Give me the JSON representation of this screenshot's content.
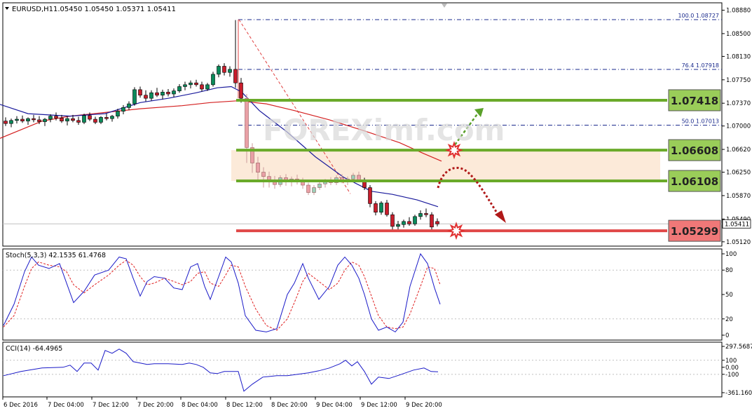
{
  "chart_data": {
    "type": "candlestick",
    "symbol": "EURUSD,H1",
    "ohlc_header": "1.05450 1.05450 1.05371 1.05411",
    "last_price": "1.05411",
    "ylim": [
      1.0505,
      1.09
    ],
    "price_ticks": [
      "1.08880",
      "1.08500",
      "1.08130",
      "1.07750",
      "1.07370",
      "1.07000",
      "1.06620",
      "1.06250",
      "1.05870",
      "1.05490",
      "1.05120"
    ],
    "time_labels": [
      "6 Dec 2016",
      "7 Dec 04:00",
      "7 Dec 12:00",
      "7 Dec 20:00",
      "8 Dec 04:00",
      "8 Dec 12:00",
      "8 Dec 20:00",
      "9 Dec 04:00",
      "9 Dec 12:00",
      "9 Dec 20:00"
    ],
    "fibonacci": [
      {
        "label": "100.0  1.08727",
        "price": 1.08727
      },
      {
        "label": "76.4  1.07918",
        "price": 1.07918
      },
      {
        "label": "50.0  1.07013",
        "price": 1.07013
      }
    ],
    "levels": [
      {
        "label": "1.07418",
        "price": 1.07418,
        "color": "#6aaa2a",
        "box": "#9acd59"
      },
      {
        "label": "1.06608",
        "price": 1.06608,
        "color": "#6aaa2a",
        "box": "#9acd59"
      },
      {
        "label": "1.06108",
        "price": 1.06108,
        "color": "#6aaa2a",
        "box": "#9acd59"
      },
      {
        "label": "1.05299",
        "price": 1.05299,
        "color": "#e04848",
        "box": "#f07878"
      }
    ],
    "zone": [
      1.06108,
      1.06608
    ],
    "candles": [
      [
        1.0708,
        1.0714,
        1.07,
        1.0704
      ],
      [
        1.0704,
        1.0712,
        1.0698,
        1.0709
      ],
      [
        1.0709,
        1.0716,
        1.0704,
        1.0711
      ],
      [
        1.0711,
        1.0717,
        1.0705,
        1.0708
      ],
      [
        1.0708,
        1.0714,
        1.0702,
        1.0712
      ],
      [
        1.0712,
        1.0718,
        1.0706,
        1.071
      ],
      [
        1.071,
        1.0716,
        1.0703,
        1.0707
      ],
      [
        1.0707,
        1.0713,
        1.07,
        1.0711
      ],
      [
        1.0711,
        1.0719,
        1.0706,
        1.0716
      ],
      [
        1.0716,
        1.0722,
        1.0709,
        1.0713
      ],
      [
        1.0713,
        1.0718,
        1.0705,
        1.0708
      ],
      [
        1.0708,
        1.0716,
        1.0701,
        1.0712
      ],
      [
        1.0712,
        1.0718,
        1.0706,
        1.0709
      ],
      [
        1.0709,
        1.0715,
        1.0702,
        1.0706
      ],
      [
        1.0706,
        1.072,
        1.0703,
        1.0717
      ],
      [
        1.0717,
        1.0722,
        1.0708,
        1.0711
      ],
      [
        1.0711,
        1.0715,
        1.0703,
        1.0706
      ],
      [
        1.0706,
        1.0716,
        1.0703,
        1.0714
      ],
      [
        1.0714,
        1.072,
        1.0709,
        1.0712
      ],
      [
        1.0712,
        1.0718,
        1.0707,
        1.0716
      ],
      [
        1.0716,
        1.0728,
        1.0712,
        1.0724
      ],
      [
        1.0724,
        1.0734,
        1.0719,
        1.073
      ],
      [
        1.073,
        1.074,
        1.0726,
        1.0736
      ],
      [
        1.0736,
        1.0763,
        1.0733,
        1.0759
      ],
      [
        1.0759,
        1.0764,
        1.0746,
        1.075
      ],
      [
        1.075,
        1.0758,
        1.074,
        1.0745
      ],
      [
        1.0745,
        1.0758,
        1.0741,
        1.0754
      ],
      [
        1.0754,
        1.0762,
        1.0747,
        1.075
      ],
      [
        1.075,
        1.0759,
        1.0743,
        1.0755
      ],
      [
        1.0755,
        1.076,
        1.0748,
        1.0752
      ],
      [
        1.0752,
        1.0761,
        1.0747,
        1.0757
      ],
      [
        1.0757,
        1.0768,
        1.0754,
        1.0764
      ],
      [
        1.0764,
        1.0772,
        1.0758,
        1.0767
      ],
      [
        1.0767,
        1.0774,
        1.0761,
        1.077
      ],
      [
        1.077,
        1.0775,
        1.0764,
        1.0767
      ],
      [
        1.0767,
        1.0772,
        1.0756,
        1.076
      ],
      [
        1.076,
        1.077,
        1.0757,
        1.0767
      ],
      [
        1.0767,
        1.0788,
        1.0764,
        1.0784
      ],
      [
        1.0784,
        1.08,
        1.0779,
        1.0797
      ],
      [
        1.0797,
        1.0802,
        1.0782,
        1.0787
      ],
      [
        1.0787,
        1.0797,
        1.078,
        1.0792
      ],
      [
        1.0792,
        1.0872,
        1.0762,
        1.077
      ],
      [
        1.077,
        1.0778,
        1.0738,
        1.0745
      ],
      [
        1.0745,
        1.0752,
        1.064,
        1.0665
      ],
      [
        1.0665,
        1.0672,
        1.0624,
        1.064
      ],
      [
        1.064,
        1.065,
        1.0612,
        1.0625
      ],
      [
        1.0625,
        1.0633,
        1.06,
        1.0618
      ],
      [
        1.0618,
        1.0626,
        1.06,
        1.061
      ],
      [
        1.061,
        1.0619,
        1.0598,
        1.0605
      ],
      [
        1.0605,
        1.062,
        1.0601,
        1.0616
      ],
      [
        1.0616,
        1.0622,
        1.0603,
        1.0609
      ],
      [
        1.0609,
        1.0618,
        1.0602,
        1.0614
      ],
      [
        1.0614,
        1.0621,
        1.0605,
        1.061
      ],
      [
        1.061,
        1.0616,
        1.0598,
        1.0604
      ],
      [
        1.0604,
        1.0608,
        1.0588,
        1.0592
      ],
      [
        1.0592,
        1.0604,
        1.0588,
        1.06
      ],
      [
        1.06,
        1.061,
        1.0596,
        1.0606
      ],
      [
        1.0606,
        1.0614,
        1.06,
        1.0611
      ],
      [
        1.0611,
        1.0617,
        1.0604,
        1.0608
      ],
      [
        1.0608,
        1.062,
        1.0604,
        1.0616
      ],
      [
        1.0616,
        1.0622,
        1.0607,
        1.0612
      ],
      [
        1.0612,
        1.0618,
        1.0604,
        1.0614
      ],
      [
        1.0614,
        1.0624,
        1.0608,
        1.062
      ],
      [
        1.062,
        1.0626,
        1.061,
        1.0612
      ],
      [
        1.0612,
        1.0616,
        1.0596,
        1.06
      ],
      [
        1.06,
        1.0604,
        1.0568,
        1.0574
      ],
      [
        1.0574,
        1.0578,
        1.0555,
        1.056
      ],
      [
        1.056,
        1.0578,
        1.0556,
        1.0575
      ],
      [
        1.0575,
        1.058,
        1.0553,
        1.0556
      ],
      [
        1.0556,
        1.056,
        1.0531,
        1.0537
      ],
      [
        1.0537,
        1.0546,
        1.0532,
        1.054
      ],
      [
        1.054,
        1.0548,
        1.0535,
        1.0545
      ],
      [
        1.0545,
        1.0552,
        1.0538,
        1.0541
      ],
      [
        1.0541,
        1.0556,
        1.0538,
        1.0553
      ],
      [
        1.0553,
        1.0563,
        1.0548,
        1.0558
      ],
      [
        1.0558,
        1.0566,
        1.0552,
        1.0556
      ],
      [
        1.0556,
        1.056,
        1.0531,
        1.0536
      ],
      [
        1.0545,
        1.055,
        1.0537,
        1.0541
      ]
    ],
    "ma_blue": [
      [
        0,
        1.0735
      ],
      [
        40,
        1.072
      ],
      [
        100,
        1.0716
      ],
      [
        150,
        1.072
      ],
      [
        200,
        1.0738
      ],
      [
        240,
        1.0745
      ],
      [
        280,
        1.0754
      ],
      [
        310,
        1.0762
      ],
      [
        330,
        1.0764
      ],
      [
        345,
        1.0755
      ],
      [
        370,
        1.0725
      ],
      [
        410,
        1.069
      ],
      [
        450,
        1.065
      ],
      [
        490,
        1.0617
      ],
      [
        530,
        1.0594
      ],
      [
        560,
        1.0589
      ],
      [
        595,
        1.058
      ],
      [
        625,
        1.0569
      ]
    ],
    "ma_red": [
      [
        0,
        1.068
      ],
      [
        60,
        1.0708
      ],
      [
        100,
        1.0716
      ],
      [
        150,
        1.0722
      ],
      [
        200,
        1.0728
      ],
      [
        260,
        1.0733
      ],
      [
        300,
        1.0738
      ],
      [
        340,
        1.0741
      ],
      [
        380,
        1.0736
      ],
      [
        420,
        1.0725
      ],
      [
        470,
        1.071
      ],
      [
        520,
        1.0692
      ],
      [
        570,
        1.0673
      ],
      [
        605,
        1.0655
      ],
      [
        630,
        1.0643
      ]
    ],
    "stoch_header": "Stoch(5,3,3) 42.1535 61.4768",
    "stoch_ticks": [
      "100",
      "80",
      "50",
      "20",
      "0"
    ],
    "stoch_main": [
      [
        5,
        12
      ],
      [
        20,
        38
      ],
      [
        35,
        78
      ],
      [
        45,
        96
      ],
      [
        55,
        86
      ],
      [
        70,
        82
      ],
      [
        85,
        88
      ],
      [
        95,
        64
      ],
      [
        105,
        40
      ],
      [
        120,
        54
      ],
      [
        135,
        74
      ],
      [
        155,
        80
      ],
      [
        170,
        96
      ],
      [
        180,
        94
      ],
      [
        190,
        70
      ],
      [
        200,
        48
      ],
      [
        210,
        66
      ],
      [
        220,
        72
      ],
      [
        235,
        70
      ],
      [
        248,
        58
      ],
      [
        260,
        56
      ],
      [
        272,
        84
      ],
      [
        282,
        88
      ],
      [
        292,
        60
      ],
      [
        300,
        44
      ],
      [
        312,
        72
      ],
      [
        322,
        96
      ],
      [
        330,
        90
      ],
      [
        340,
        64
      ],
      [
        350,
        24
      ],
      [
        365,
        6
      ],
      [
        380,
        4
      ],
      [
        395,
        8
      ],
      [
        410,
        50
      ],
      [
        420,
        64
      ],
      [
        432,
        88
      ],
      [
        440,
        70
      ],
      [
        455,
        44
      ],
      [
        470,
        60
      ],
      [
        482,
        86
      ],
      [
        492,
        96
      ],
      [
        502,
        86
      ],
      [
        512,
        70
      ],
      [
        520,
        50
      ],
      [
        530,
        20
      ],
      [
        540,
        6
      ],
      [
        552,
        10
      ],
      [
        564,
        4
      ],
      [
        575,
        16
      ],
      [
        585,
        60
      ],
      [
        600,
        100
      ],
      [
        610,
        88
      ],
      [
        620,
        58
      ],
      [
        628,
        38
      ]
    ],
    "stoch_signal": [
      [
        5,
        10
      ],
      [
        20,
        24
      ],
      [
        35,
        60
      ],
      [
        45,
        82
      ],
      [
        55,
        90
      ],
      [
        70,
        86
      ],
      [
        85,
        84
      ],
      [
        95,
        78
      ],
      [
        105,
        62
      ],
      [
        120,
        52
      ],
      [
        135,
        62
      ],
      [
        155,
        74
      ],
      [
        170,
        86
      ],
      [
        180,
        92
      ],
      [
        190,
        86
      ],
      [
        200,
        72
      ],
      [
        210,
        62
      ],
      [
        220,
        64
      ],
      [
        235,
        70
      ],
      [
        248,
        66
      ],
      [
        260,
        62
      ],
      [
        272,
        66
      ],
      [
        282,
        76
      ],
      [
        292,
        78
      ],
      [
        300,
        64
      ],
      [
        312,
        60
      ],
      [
        322,
        74
      ],
      [
        330,
        86
      ],
      [
        340,
        84
      ],
      [
        350,
        60
      ],
      [
        365,
        32
      ],
      [
        380,
        12
      ],
      [
        395,
        6
      ],
      [
        410,
        20
      ],
      [
        420,
        40
      ],
      [
        432,
        66
      ],
      [
        440,
        76
      ],
      [
        455,
        66
      ],
      [
        470,
        56
      ],
      [
        482,
        64
      ],
      [
        492,
        80
      ],
      [
        502,
        90
      ],
      [
        512,
        86
      ],
      [
        520,
        72
      ],
      [
        530,
        48
      ],
      [
        540,
        24
      ],
      [
        552,
        10
      ],
      [
        564,
        8
      ],
      [
        575,
        10
      ],
      [
        585,
        26
      ],
      [
        600,
        60
      ],
      [
        610,
        84
      ],
      [
        620,
        82
      ],
      [
        628,
        62
      ]
    ],
    "cci_header": "CCI(14) -64.4965",
    "cci_ticks": [
      "297.5687",
      "100",
      "0.00",
      "-100",
      "-361.1603"
    ],
    "cci": [
      [
        5,
        -120
      ],
      [
        30,
        -60
      ],
      [
        60,
        -10
      ],
      [
        90,
        0
      ],
      [
        100,
        30
      ],
      [
        110,
        -60
      ],
      [
        120,
        60
      ],
      [
        130,
        60
      ],
      [
        140,
        -40
      ],
      [
        150,
        240
      ],
      [
        160,
        200
      ],
      [
        170,
        260
      ],
      [
        180,
        200
      ],
      [
        190,
        80
      ],
      [
        200,
        60
      ],
      [
        210,
        40
      ],
      [
        220,
        50
      ],
      [
        240,
        50
      ],
      [
        260,
        40
      ],
      [
        270,
        60
      ],
      [
        280,
        40
      ],
      [
        290,
        0
      ],
      [
        300,
        -80
      ],
      [
        310,
        -90
      ],
      [
        320,
        -60
      ],
      [
        330,
        -60
      ],
      [
        340,
        -60
      ],
      [
        348,
        -340
      ],
      [
        360,
        -240
      ],
      [
        375,
        -140
      ],
      [
        395,
        -120
      ],
      [
        410,
        -120
      ],
      [
        425,
        -100
      ],
      [
        440,
        -80
      ],
      [
        455,
        -50
      ],
      [
        470,
        -10
      ],
      [
        485,
        50
      ],
      [
        493,
        100
      ],
      [
        502,
        20
      ],
      [
        510,
        80
      ],
      [
        520,
        -60
      ],
      [
        530,
        -240
      ],
      [
        540,
        -140
      ],
      [
        555,
        -160
      ],
      [
        570,
        -110
      ],
      [
        590,
        -40
      ],
      [
        605,
        -10
      ],
      [
        615,
        -60
      ],
      [
        625,
        -64
      ]
    ]
  },
  "watermark": "FOREXimf.com"
}
